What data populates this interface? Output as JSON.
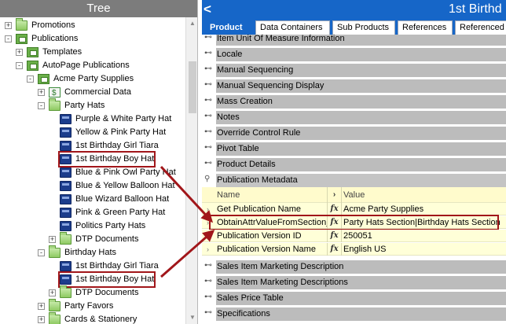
{
  "tree": {
    "header": "Tree",
    "items": [
      {
        "label": "Promotions",
        "icon": "folder-icon",
        "level": 0,
        "expander": "+"
      },
      {
        "label": "Publications",
        "icon": "publication-icon",
        "level": 0,
        "expander": "-"
      },
      {
        "label": "Templates",
        "icon": "publication-icon",
        "level": 1,
        "expander": "+"
      },
      {
        "label": "AutoPage Publications",
        "icon": "publication-icon",
        "level": 1,
        "expander": "-"
      },
      {
        "label": "Acme Party Supplies",
        "icon": "publication-icon",
        "level": 2,
        "expander": "-"
      },
      {
        "label": "Commercial Data",
        "icon": "data-icon",
        "level": 3,
        "expander": "+"
      },
      {
        "label": "Party Hats",
        "icon": "folder-icon",
        "level": 3,
        "expander": "-"
      },
      {
        "label": "Purple & White Party Hat",
        "icon": "page-icon",
        "level": 4,
        "expander": ""
      },
      {
        "label": "Yellow & Pink Party Hat",
        "icon": "page-icon",
        "level": 4,
        "expander": ""
      },
      {
        "label": "1st Birthday Girl Tiara",
        "icon": "page-icon",
        "level": 4,
        "expander": ""
      },
      {
        "label": "1st Birthday Boy Hat",
        "icon": "page-icon",
        "level": 4,
        "expander": "",
        "highlight": true
      },
      {
        "label": "Blue & Pink Owl Party Hat",
        "icon": "page-icon",
        "level": 4,
        "expander": ""
      },
      {
        "label": "Blue & Yellow Balloon Hat",
        "icon": "page-icon",
        "level": 4,
        "expander": ""
      },
      {
        "label": "Blue Wizard Balloon Hat",
        "icon": "page-icon",
        "level": 4,
        "expander": ""
      },
      {
        "label": "Pink & Green Party Hat",
        "icon": "page-icon",
        "level": 4,
        "expander": ""
      },
      {
        "label": "Politics Party Hats",
        "icon": "page-icon",
        "level": 4,
        "expander": ""
      },
      {
        "label": "DTP Documents",
        "icon": "folder-icon",
        "level": 4,
        "expander": "+"
      },
      {
        "label": "Birthday Hats",
        "icon": "folder-icon",
        "level": 3,
        "expander": "-"
      },
      {
        "label": "1st Birthday Girl Tiara",
        "icon": "page-icon",
        "level": 4,
        "expander": ""
      },
      {
        "label": "1st Birthday Boy Hat",
        "icon": "page-icon",
        "level": 4,
        "expander": "",
        "highlight": true
      },
      {
        "label": "DTP Documents",
        "icon": "folder-icon",
        "level": 4,
        "expander": "+"
      },
      {
        "label": "Party Favors",
        "icon": "folder-icon",
        "level": 3,
        "expander": "+"
      },
      {
        "label": "Cards & Stationery",
        "icon": "folder-icon",
        "level": 3,
        "expander": "+"
      }
    ]
  },
  "editor": {
    "title": "1st Birthd",
    "tabs": [
      {
        "label": "Product",
        "active": true
      },
      {
        "label": "Data Containers",
        "active": false
      },
      {
        "label": "Sub Products",
        "active": false
      },
      {
        "label": "References",
        "active": false
      },
      {
        "label": "Referenced",
        "active": false
      }
    ],
    "sections_top": [
      "Item Unit Of Measure Information",
      "Locale",
      "Manual Sequencing",
      "Manual Sequencing Display",
      "Mass Creation",
      "Notes",
      "Override Control Rule",
      "Pivot Table",
      "Product Details"
    ],
    "open_section": "Publication Metadata",
    "grid": {
      "header": {
        "name": "Name",
        "value": "Value"
      },
      "rows": [
        {
          "name": "Get Publication Name",
          "fx": "fx",
          "value": "Acme Party Supplies"
        },
        {
          "name": "ObtainAttrValueFromSection_",
          "fx": "fx",
          "value": "Party Hats Section|Birthday Hats Section",
          "highlight": true
        },
        {
          "name": "Publication Version ID",
          "fx": "fx",
          "value": "250051"
        },
        {
          "name": "Publication Version Name",
          "fx": "fx",
          "value": "English US"
        }
      ]
    },
    "sections_bottom": [
      "Sales Item Marketing Description",
      "Sales Item Marketing Descriptions",
      "Sales Price Table",
      "Specifications"
    ]
  },
  "colors": {
    "accent": "#1666c8",
    "highlight": "#a1161a",
    "section": "#bcbcbc",
    "grid": "#ffffd8"
  }
}
